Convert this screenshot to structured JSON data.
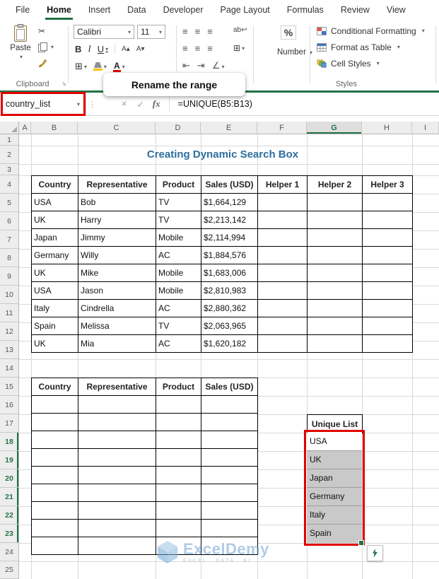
{
  "colors": {
    "accent_green": "#217346",
    "highlight_red": "#E10000",
    "title_blue": "#2E6E9E",
    "selection_gray": "#C9C9C9",
    "watermark_blue": "#6FA3D2"
  },
  "icons": {
    "chevron": "▾",
    "scissors": "✂",
    "cancel": "×",
    "check": "✓",
    "dots": "⋮",
    "borders_grid": "⊞",
    "merge_grid": "⊞",
    "align_lines": "≡",
    "wrap_text": "ab↩",
    "grow_font": "A▴",
    "shrink_font": "A▾",
    "indent_left": "⇤",
    "indent_right": "⇥",
    "orientation": "∠",
    "font_color_letter": "A",
    "launcher": "⇘"
  },
  "ribbon": {
    "tabs": [
      {
        "label": "File",
        "active": false
      },
      {
        "label": "Home",
        "active": true
      },
      {
        "label": "Insert",
        "active": false
      },
      {
        "label": "Data",
        "active": false
      },
      {
        "label": "Developer",
        "active": false
      },
      {
        "label": "Page Layout",
        "active": false
      },
      {
        "label": "Formulas",
        "active": false
      },
      {
        "label": "Review",
        "active": false
      },
      {
        "label": "View",
        "active": false
      }
    ],
    "clipboard": {
      "paste_label": "Paste",
      "group_label": "Clipboard"
    },
    "font": {
      "family": "Calibri",
      "size": "11",
      "bold": "B",
      "italic": "I",
      "underline": "U"
    },
    "number": {
      "percent": "%",
      "format_label": "Number"
    },
    "styles": {
      "items": [
        "Conditional Formatting",
        "Format as Table",
        "Cell Styles"
      ],
      "group_label": "Styles"
    }
  },
  "callout": {
    "text": "Rename the range"
  },
  "formula_bar": {
    "name_box_value": "country_list",
    "formula": "=UNIQUE(B5:B13)",
    "fx_label": "fx"
  },
  "sheet": {
    "title": "Creating Dynamic Search Box",
    "column_headers": [
      "A",
      "B",
      "C",
      "D",
      "E",
      "F",
      "G",
      "H",
      "I"
    ],
    "selected_column": "G",
    "row_headers": [
      "1",
      "2",
      "3",
      "4",
      "5",
      "6",
      "7",
      "8",
      "9",
      "10",
      "11",
      "12",
      "13",
      "14",
      "15",
      "16",
      "17",
      "18",
      "19",
      "20",
      "21",
      "22",
      "23",
      "24",
      "25"
    ],
    "selected_rows": [
      "18",
      "19",
      "20",
      "21",
      "22",
      "23"
    ]
  },
  "main_table": {
    "headers": [
      "Country",
      "Representative",
      "Product",
      "Sales (USD)",
      "Helper 1",
      "Helper 2",
      "Helper 3"
    ],
    "rows": [
      [
        "USA",
        "Bob",
        "TV",
        "$1,664,129",
        "",
        "",
        ""
      ],
      [
        "UK",
        "Harry",
        "TV",
        "$2,213,142",
        "",
        "",
        ""
      ],
      [
        "Japan",
        "Jimmy",
        "Mobile",
        "$2,114,994",
        "",
        "",
        ""
      ],
      [
        "Germany",
        "Willy",
        "AC",
        "$1,884,576",
        "",
        "",
        ""
      ],
      [
        "UK",
        "Mike",
        "Mobile",
        "$1,683,006",
        "",
        "",
        ""
      ],
      [
        "USA",
        "Jason",
        "Mobile",
        "$2,810,983",
        "",
        "",
        ""
      ],
      [
        "Italy",
        "Cindrella",
        "AC",
        "$2,880,362",
        "",
        "",
        ""
      ],
      [
        "Spain",
        "Melissa",
        "TV",
        "$2,063,965",
        "",
        "",
        ""
      ],
      [
        "UK",
        "Mia",
        "AC",
        "$1,620,182",
        "",
        "",
        ""
      ]
    ]
  },
  "entry_table": {
    "headers": [
      "Country",
      "Representative",
      "Product",
      "Sales (USD)"
    ],
    "empty_row_count": 9
  },
  "unique_list": {
    "header": "Unique List",
    "items": [
      "USA",
      "UK",
      "Japan",
      "Germany",
      "Italy",
      "Spain"
    ]
  },
  "watermark": {
    "brand": "ExcelDemy",
    "tagline": "EXCEL · DATA · BI"
  }
}
